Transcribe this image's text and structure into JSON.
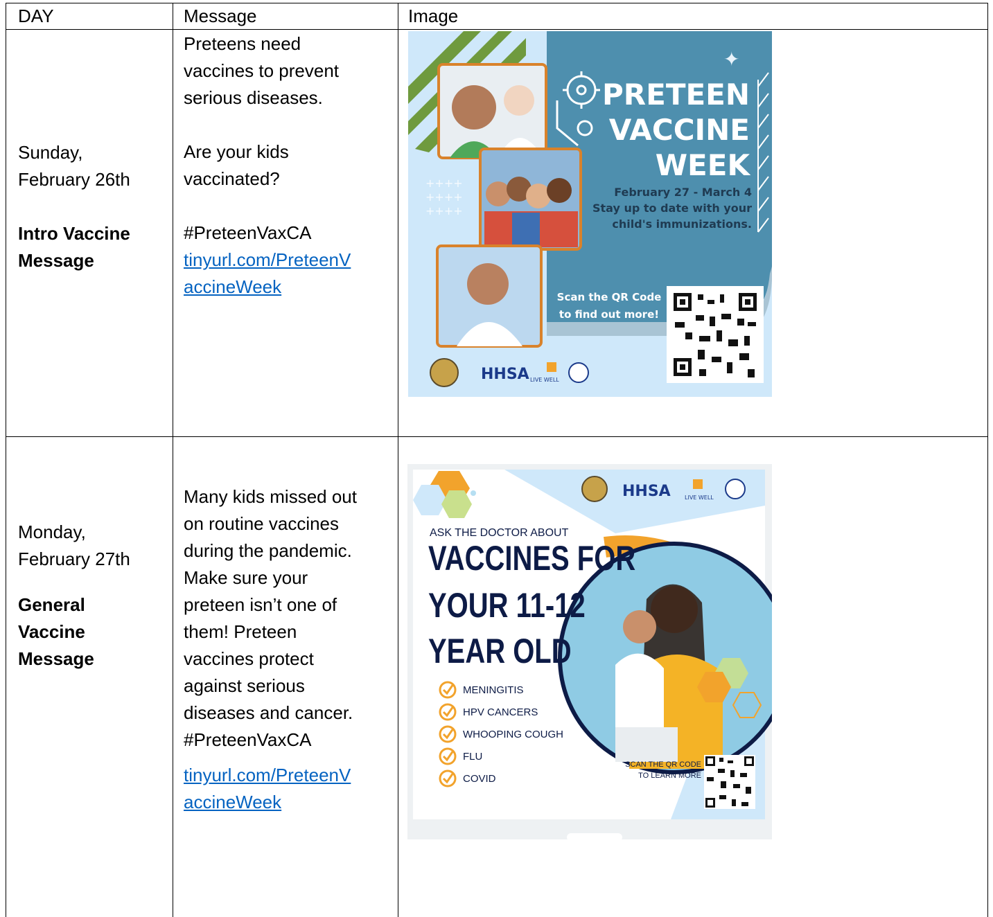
{
  "headers": {
    "day": "DAY",
    "message": "Message",
    "image": "Image"
  },
  "rows": [
    {
      "day": "Sunday, February 26th",
      "day_lines": [
        "Sunday,",
        "February 26th"
      ],
      "type_lines": [
        "Intro Vaccine",
        "Message"
      ],
      "message_lines": [
        "Preteens need",
        "vaccines to prevent",
        "serious diseases.",
        "",
        "Are your kids",
        "vaccinated?",
        "",
        "#PreteenVaxCA"
      ],
      "link_lines": [
        "tinyurl.com/PreteenV",
        "accineWeek"
      ],
      "poster": {
        "title_lines": [
          "PRETEEN",
          "VACCINE",
          "WEEK"
        ],
        "dates": "February 27 - March 4",
        "tagline_lines": [
          "Stay up to date with your",
          "child's immunizations."
        ],
        "qr_lines": [
          "Scan the QR Code",
          "to find out more!"
        ],
        "logo": "HHSA",
        "logo2": "LIVE WELL",
        "colors": {
          "teal": "#4e8fae",
          "orange": "#d9822b",
          "green": "#6f9a3e",
          "light": "#cfe8fa"
        }
      }
    },
    {
      "day": "Monday, February 27th",
      "day_lines": [
        "Monday,",
        "February 27th"
      ],
      "type_lines": [
        "General",
        "Vaccine",
        "Message"
      ],
      "message_lines": [
        "Many kids missed out",
        "on routine vaccines",
        "during the pandemic.",
        "Make sure your",
        "preteen isn’t one of",
        "them! Preteen",
        "vaccines protect",
        "against serious",
        "diseases and cancer.",
        "#PreteenVaxCA"
      ],
      "link_lines": [
        "tinyurl.com/PreteenV",
        "accineWeek"
      ],
      "poster": {
        "kicker": "ASK THE DOCTOR ABOUT",
        "title_lines": [
          "VACCINES FOR",
          "YOUR 11-12",
          "YEAR OLD"
        ],
        "items": [
          "MENINGITIS",
          "HPV CANCERS",
          "WHOOPING COUGH",
          "FLU",
          "COVID"
        ],
        "qr_lines": [
          "SCAN THE QR CODE",
          "TO LEARN MORE"
        ],
        "logo": "HHSA",
        "logo2": "LIVE WELL",
        "colors": {
          "navy": "#0d1b46",
          "orange": "#f2a32c",
          "light": "#cfe8fa"
        }
      }
    }
  ]
}
